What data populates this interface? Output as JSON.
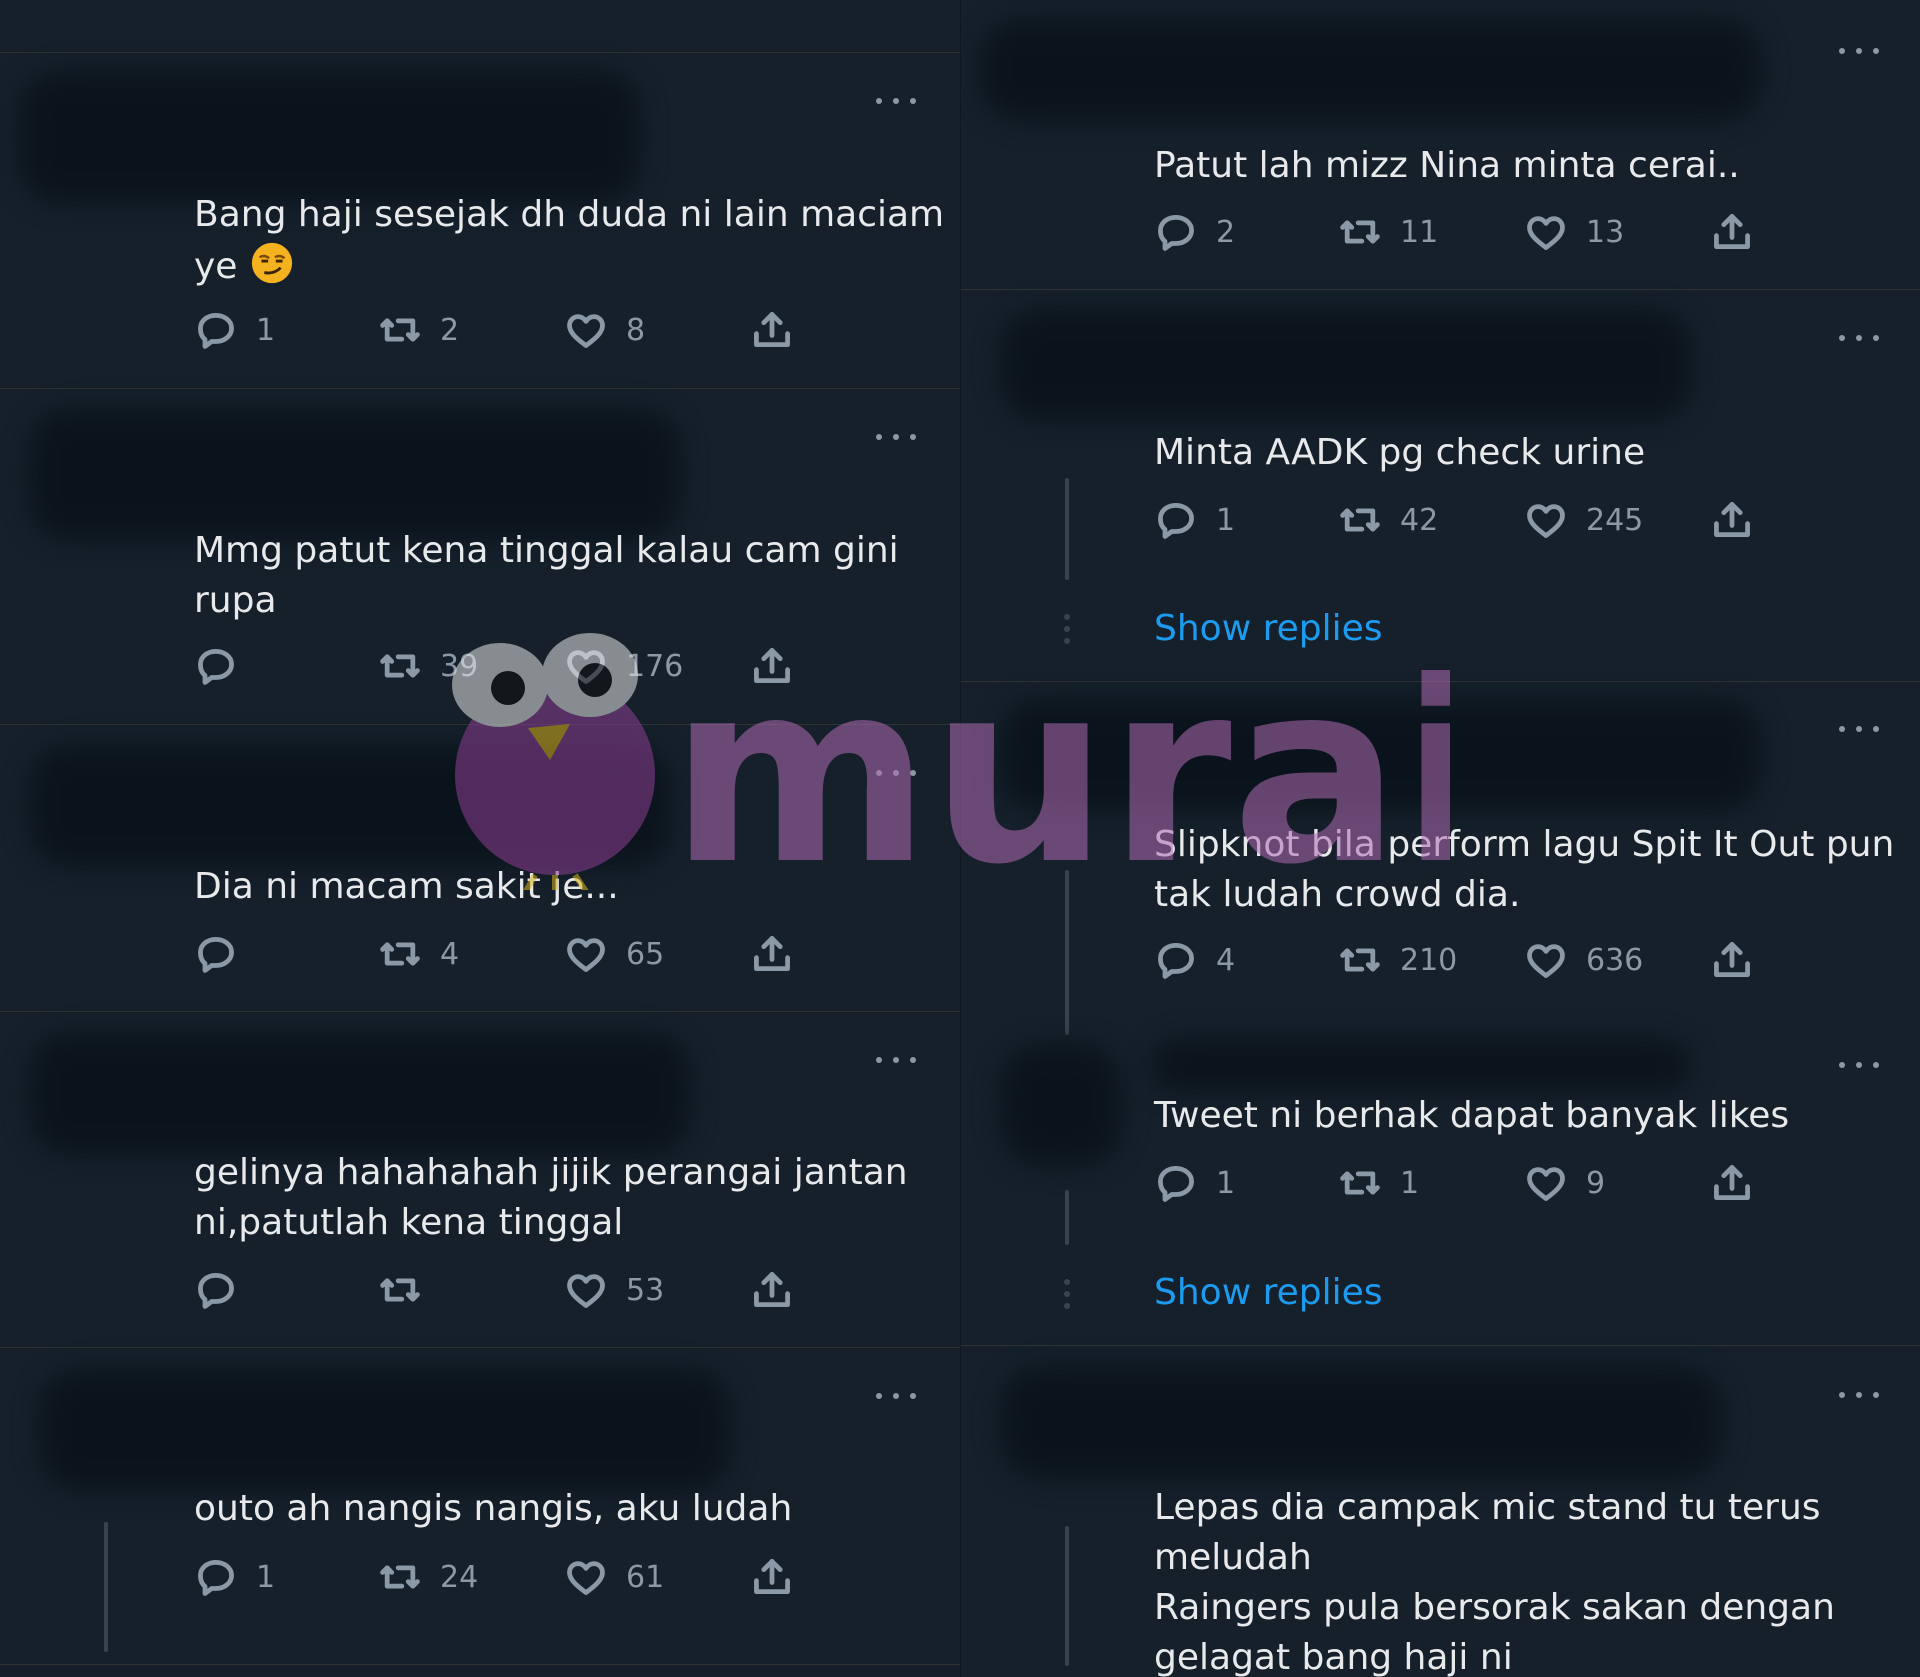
{
  "left_tweets": [
    {
      "text": "Bang haji sesejak dh duda ni lain maciam\nye",
      "emoji": "smirking-face",
      "reply": "1",
      "retweet": "2",
      "like": "8"
    },
    {
      "text": "Mmg patut kena tinggal kalau cam gini\nrupa",
      "reply": "",
      "retweet": "39",
      "like": "176"
    },
    {
      "text": "Dia ni macam sakit je...",
      "reply": "",
      "retweet": "4",
      "like": "65"
    },
    {
      "text": "gelinya hahahahah jijik perangai jantan\nni,patutlah kena tinggal",
      "reply": "",
      "retweet": "",
      "like": "53"
    },
    {
      "text": "outo ah nangis nangis, aku ludah",
      "reply": "1",
      "retweet": "24",
      "like": "61"
    }
  ],
  "right_tweets": [
    {
      "text": "Patut lah mizz Nina minta cerai..",
      "reply": "2",
      "retweet": "11",
      "like": "13"
    },
    {
      "text": "Minta AADK pg check urine",
      "reply": "1",
      "retweet": "42",
      "like": "245"
    },
    {
      "text": "Slipknot bila perform lagu Spit It Out pun\ntak ludah crowd dia.",
      "reply": "4",
      "retweet": "210",
      "like": "636"
    },
    {
      "text": "Tweet ni berhak dapat banyak likes",
      "reply": "1",
      "retweet": "1",
      "like": "9"
    },
    {
      "text": "Lepas dia campak mic stand tu terus\nmeludah\nRaingers pula bersorak sakan dengan\ngelagat bang haji ni"
    }
  ],
  "show_replies_1": "Show replies",
  "show_replies_2": "Show replies",
  "watermark": {
    "text": "murai",
    "color": "#a35fa6"
  }
}
